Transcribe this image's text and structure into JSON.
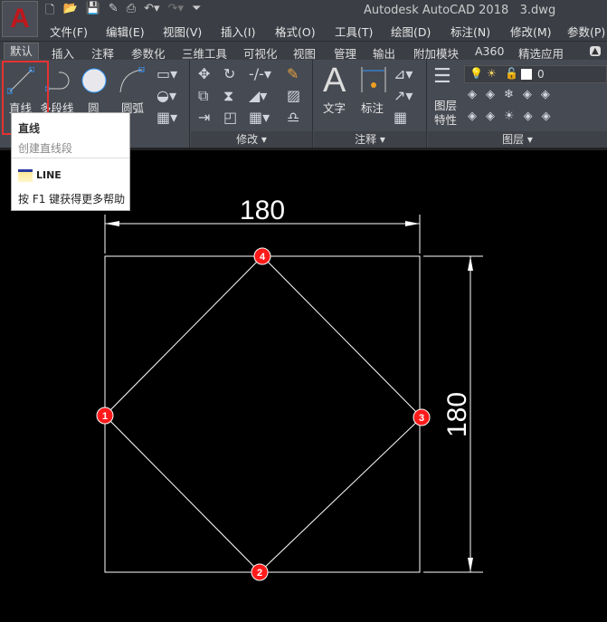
{
  "app": {
    "title": "Autodesk AutoCAD 2018",
    "file": "3.dwg",
    "logo": "A"
  },
  "menu": [
    "文件(F)",
    "编辑(E)",
    "视图(V)",
    "插入(I)",
    "格式(O)",
    "工具(T)",
    "绘图(D)",
    "标注(N)",
    "修改(M)",
    "参数(P)"
  ],
  "tabs": [
    "默认",
    "插入",
    "注释",
    "参数化",
    "三维工具",
    "可视化",
    "视图",
    "管理",
    "输出",
    "附加模块",
    "A360",
    "精选应用"
  ],
  "draw": {
    "line": "直线",
    "polyline": "多段线",
    "circle": "圆",
    "arc": "圆弧"
  },
  "panels": {
    "modify": "修改",
    "annotation": "注释",
    "layers": "图层"
  },
  "annotation": {
    "text": "文字",
    "dim": "标注"
  },
  "layers": {
    "props_1": "图层",
    "props_2": "特性",
    "current": "0"
  },
  "tooltip": {
    "title": "直线",
    "desc": "创建直线段",
    "command": "LINE",
    "help": "按 F1 键获得更多帮助"
  },
  "drawing": {
    "dim_h": "180",
    "dim_v": "180",
    "points": [
      "1",
      "2",
      "3",
      "4"
    ],
    "point_color": "#ff1a1a"
  }
}
